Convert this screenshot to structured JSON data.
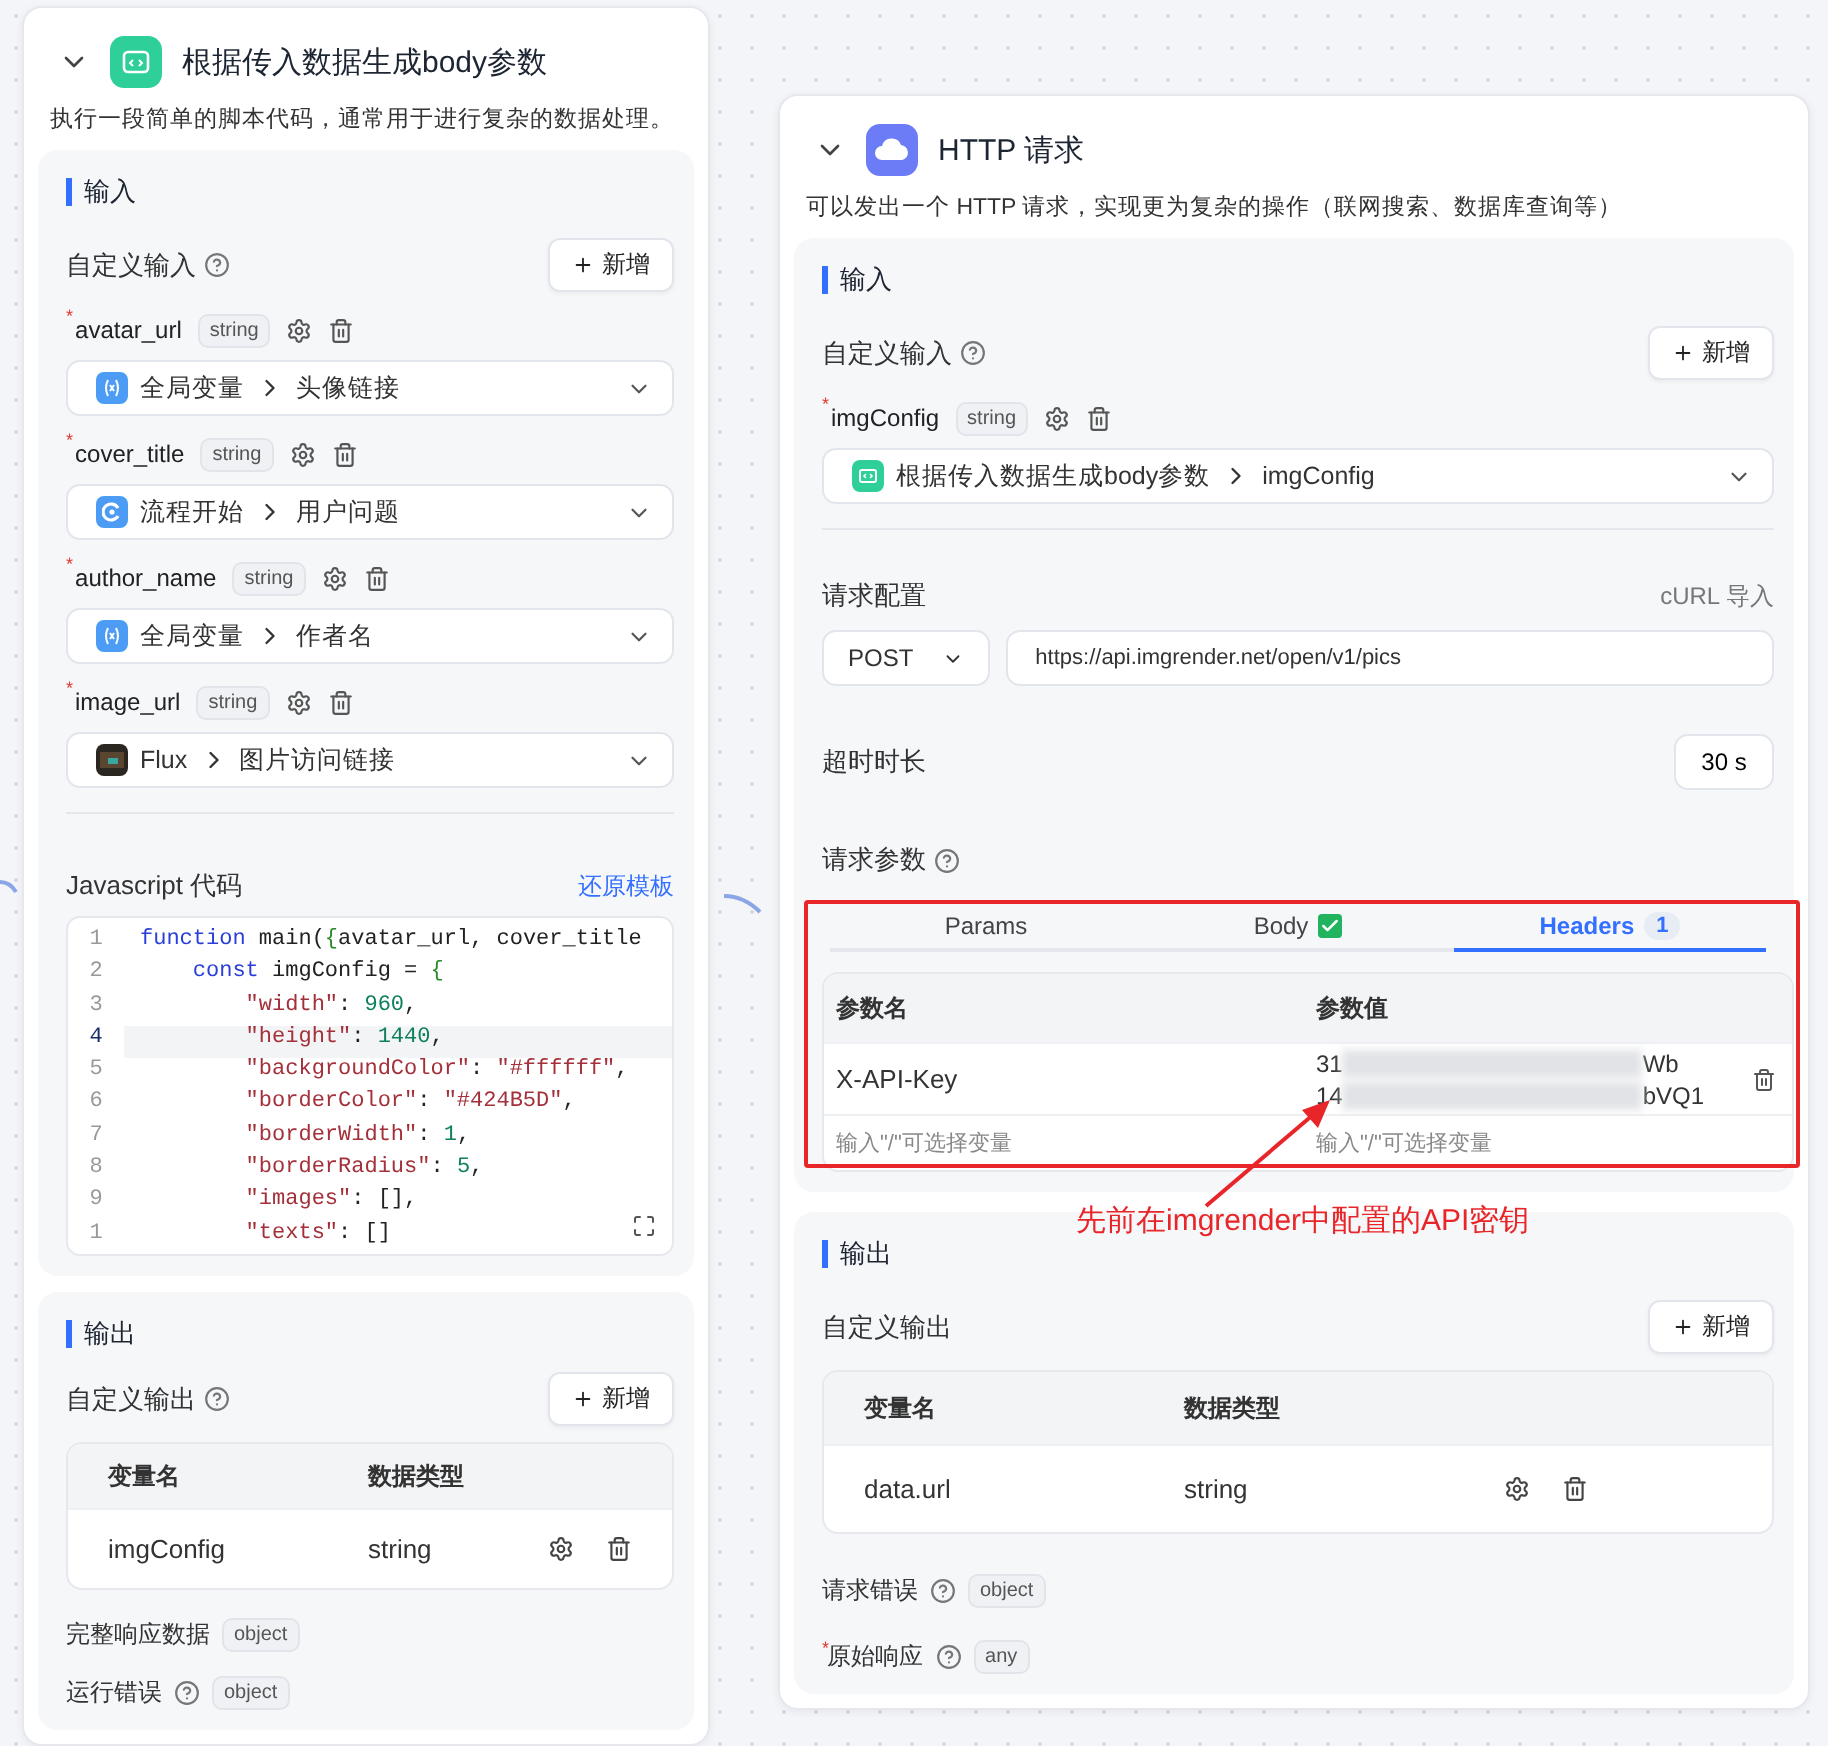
{
  "code_node": {
    "title": "根据传入数据生成body参数",
    "expanded": true,
    "description": "执行一段简单的脚本代码，通常用于进行复杂的数据处理。",
    "input": {
      "title": "输入",
      "custom_label": "自定义输入",
      "add_button": "新增",
      "inputs": [
        {
          "required_mark": "*",
          "name": "avatar_url",
          "type": "string",
          "source": {
            "kind": "variable",
            "node": "全局变量",
            "field": "头像链接"
          }
        },
        {
          "required_mark": "*",
          "name": "cover_title",
          "type": "string",
          "source": {
            "kind": "start",
            "node": "流程开始",
            "field": "用户问题"
          }
        },
        {
          "required_mark": "*",
          "name": "author_name",
          "type": "string",
          "source": {
            "kind": "variable",
            "node": "全局变量",
            "field": "作者名"
          }
        },
        {
          "required_mark": "*",
          "name": "image_url",
          "type": "string",
          "source": {
            "kind": "image",
            "node": "Flux",
            "field": "图片访问链接"
          }
        }
      ],
      "code_label": "Javascript 代码",
      "restore_link": "还原模板",
      "code_lines": [
        {
          "number": "1",
          "active": false,
          "tokens": [
            {
              "kind": "keyword",
              "text": "function"
            },
            {
              "kind": "plain",
              "text": " main("
            },
            {
              "kind": "punct",
              "text": "{"
            },
            {
              "kind": "plain",
              "text": "avatar_url, cover_title"
            }
          ]
        },
        {
          "number": "2",
          "active": false,
          "tokens": [
            {
              "kind": "keyword",
              "text": "    const"
            },
            {
              "kind": "plain",
              "text": " imgConfig = "
            },
            {
              "kind": "punct",
              "text": "{"
            }
          ]
        },
        {
          "number": "3",
          "active": false,
          "tokens": [
            {
              "kind": "string",
              "text": "        \"width\""
            },
            {
              "kind": "plain",
              "text": ": "
            },
            {
              "kind": "number",
              "text": "960"
            },
            {
              "kind": "plain",
              "text": ","
            }
          ]
        },
        {
          "number": "4",
          "active": true,
          "tokens": [
            {
              "kind": "string",
              "text": "        \"height\""
            },
            {
              "kind": "plain",
              "text": ": "
            },
            {
              "kind": "number",
              "text": "1440"
            },
            {
              "kind": "plain",
              "text": ","
            }
          ]
        },
        {
          "number": "5",
          "active": false,
          "tokens": [
            {
              "kind": "string",
              "text": "        \"backgroundColor\""
            },
            {
              "kind": "plain",
              "text": ": "
            },
            {
              "kind": "string",
              "text": "\"#ffffff\""
            },
            {
              "kind": "plain",
              "text": ","
            }
          ]
        },
        {
          "number": "6",
          "active": false,
          "tokens": [
            {
              "kind": "string",
              "text": "        \"borderColor\""
            },
            {
              "kind": "plain",
              "text": ": "
            },
            {
              "kind": "string",
              "text": "\"#424B5D\""
            },
            {
              "kind": "plain",
              "text": ","
            }
          ]
        },
        {
          "number": "7",
          "active": false,
          "tokens": [
            {
              "kind": "string",
              "text": "        \"borderWidth\""
            },
            {
              "kind": "plain",
              "text": ": "
            },
            {
              "kind": "number",
              "text": "1"
            },
            {
              "kind": "plain",
              "text": ","
            }
          ]
        },
        {
          "number": "8",
          "active": false,
          "tokens": [
            {
              "kind": "string",
              "text": "        \"borderRadius\""
            },
            {
              "kind": "plain",
              "text": ": "
            },
            {
              "kind": "number",
              "text": "5"
            },
            {
              "kind": "plain",
              "text": ","
            }
          ]
        },
        {
          "number": "9",
          "active": false,
          "tokens": [
            {
              "kind": "string",
              "text": "        \"images\""
            },
            {
              "kind": "plain",
              "text": ": [],"
            }
          ]
        },
        {
          "number": "1",
          "active": false,
          "tokens": [
            {
              "kind": "string",
              "text": "        \"texts\""
            },
            {
              "kind": "plain",
              "text": ": []"
            }
          ]
        }
      ]
    },
    "output": {
      "title": "输出",
      "custom_label": "自定义输出",
      "custom_help": true,
      "add_button": "新增",
      "columns": [
        "变量名",
        "数据类型"
      ],
      "rows": [
        {
          "name": "imgConfig",
          "type": "string"
        }
      ],
      "extras": [
        {
          "label": "完整响应数据",
          "help": false,
          "type": "object"
        },
        {
          "label": "运行错误",
          "help": true,
          "type": "object"
        }
      ]
    }
  },
  "http_node": {
    "title": "HTTP 请求",
    "expanded": true,
    "description": "可以发出一个 HTTP 请求，实现更为复杂的操作（联网搜索、数据库查询等）",
    "input": {
      "title": "输入",
      "custom_label": "自定义输入",
      "add_button": "新增",
      "inputs": [
        {
          "required_mark": "*",
          "name": "imgConfig",
          "type": "string",
          "source": {
            "kind": "code",
            "node": "根据传入数据生成body参数",
            "field": "imgConfig"
          }
        }
      ],
      "request_label": "请求配置",
      "curl_link": "cURL 导入",
      "method": "POST",
      "url": "https://api.imgrender.net/open/v1/pics",
      "timeout_label": "超时时长",
      "timeout": "30 s",
      "params_label": "请求参数",
      "tabs": [
        {
          "label": "Params",
          "selected": false,
          "checked": false
        },
        {
          "label": "Body",
          "selected": false,
          "checked": true
        },
        {
          "label": "Headers",
          "selected": true,
          "checked": false,
          "count": "1"
        }
      ],
      "columns": [
        "参数名",
        "参数值"
      ],
      "rows": [
        {
          "name": "X-API-Key",
          "value_lines": [
            {
              "start": "31",
              "end": "Wb"
            },
            {
              "start": "14",
              "end": "bVQ1"
            }
          ]
        }
      ],
      "placeholders": [
        "输入\"/\"可选择变量",
        "输入\"/\"可选择变量"
      ]
    },
    "output": {
      "title": "输出",
      "custom_label": "自定义输出",
      "custom_help": false,
      "add_button": "新增",
      "columns": [
        "变量名",
        "数据类型"
      ],
      "rows": [
        {
          "name": "data.url",
          "type": "string"
        }
      ],
      "extras": [
        {
          "label": "请求错误",
          "help": true,
          "type": "object"
        },
        {
          "required_mark": "*",
          "label": "原始响应",
          "help": true,
          "type": "any"
        }
      ]
    }
  },
  "annotation": {
    "text": "先前在imgrender中配置的API密钥"
  }
}
